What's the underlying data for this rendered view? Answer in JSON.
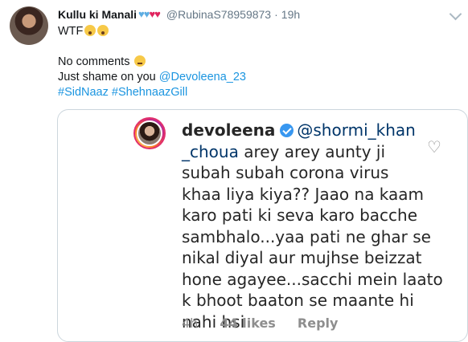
{
  "tweet": {
    "display_name": "Kullu ki Manali",
    "handle": "@RubinaS78959873",
    "time": "19h",
    "lines": {
      "l1": "WTF",
      "l2": "No comments",
      "l3_text": "Just shame on you ",
      "l3_mention": "@Devoleena_23",
      "l4_tag1": "#SidNaaz",
      "l4_tag2": "#ShehnaazGill"
    }
  },
  "embed": {
    "username": "devoleena",
    "mention_part1": "@shormi_khan",
    "mention_part2": "_choua",
    "comment_lines": [
      " arey arey aunty ji",
      "subah subah corona virus",
      "khaa liya kiya?? Jaao na kaam",
      "karo pati ki seva karo bacche",
      "sambhalo...yaa pati ne ghar se",
      "nikal diyal aur mujhse beizzat",
      "hone agayee...sacchi mein laato",
      "k bhoot baaton se maante hi",
      "nahi hsi"
    ],
    "time": "4h",
    "likes": "44 likes",
    "reply": "Reply"
  },
  "colors": {
    "link": "#1b95e0",
    "ig_mention": "#003569",
    "muted": "#657786"
  },
  "icons": [
    "avatar",
    "blue-heart-icon",
    "red-heart-icon",
    "caret-down-icon",
    "astonished-emoji-icon",
    "neutral-emoji-icon",
    "verified-badge-icon",
    "heart-outline-icon"
  ]
}
